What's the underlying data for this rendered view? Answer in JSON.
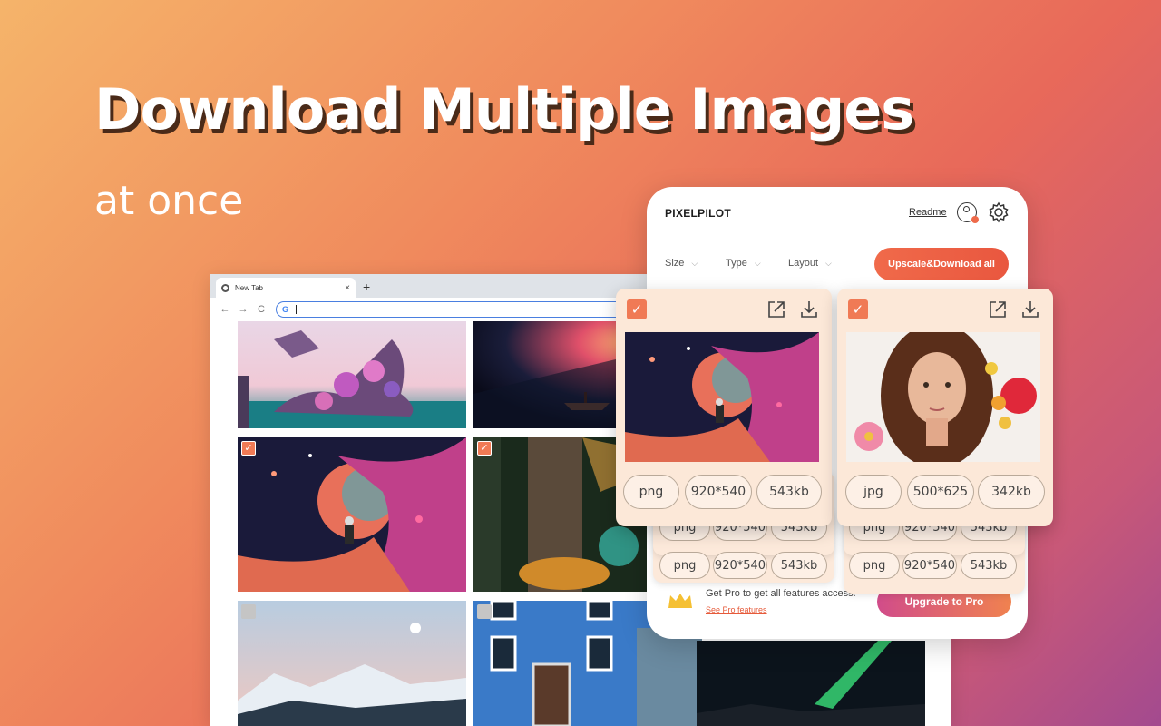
{
  "hero": {
    "title": "Download Multiple Images",
    "subtitle": "at once"
  },
  "browser": {
    "tab_title": "New Tab",
    "tab_close": "×",
    "new_tab": "+",
    "back": "←",
    "forward": "→",
    "reload": "C",
    "omnibox_logo": "G",
    "tiles": [
      {
        "name": "dragon-island-image",
        "checked": null
      },
      {
        "name": "space-boat-image",
        "checked": null
      },
      {
        "name": "astronaut-planet-image",
        "checked": true
      },
      {
        "name": "forest-tunnel-image",
        "checked": true
      },
      {
        "name": "snowy-mountains-image",
        "checked": false
      },
      {
        "name": "blue-house-image",
        "checked": false
      },
      {
        "name": "aurora-night-image",
        "checked": null
      }
    ]
  },
  "extension": {
    "brand": "PIXELPILOT",
    "readme": "Readme",
    "filters": [
      "Size",
      "Type",
      "Layout"
    ],
    "upscale_label": "Upscale&Download all",
    "pro_text": "Get Pro to get all features access.",
    "pro_link": "See Pro features",
    "upgrade_label": "Upgrade to Pro",
    "accent": "#f06a4a",
    "cards": [
      {
        "format": "png",
        "dimensions": "920*540",
        "size": "543kb"
      },
      {
        "format": "jpg",
        "dimensions": "500*625",
        "size": "342kb"
      }
    ],
    "stack_rows": [
      {
        "format": "png",
        "dimensions": "920*540",
        "size": "543kb"
      },
      {
        "format": "png",
        "dimensions": "920*540",
        "size": "543kb"
      }
    ]
  }
}
